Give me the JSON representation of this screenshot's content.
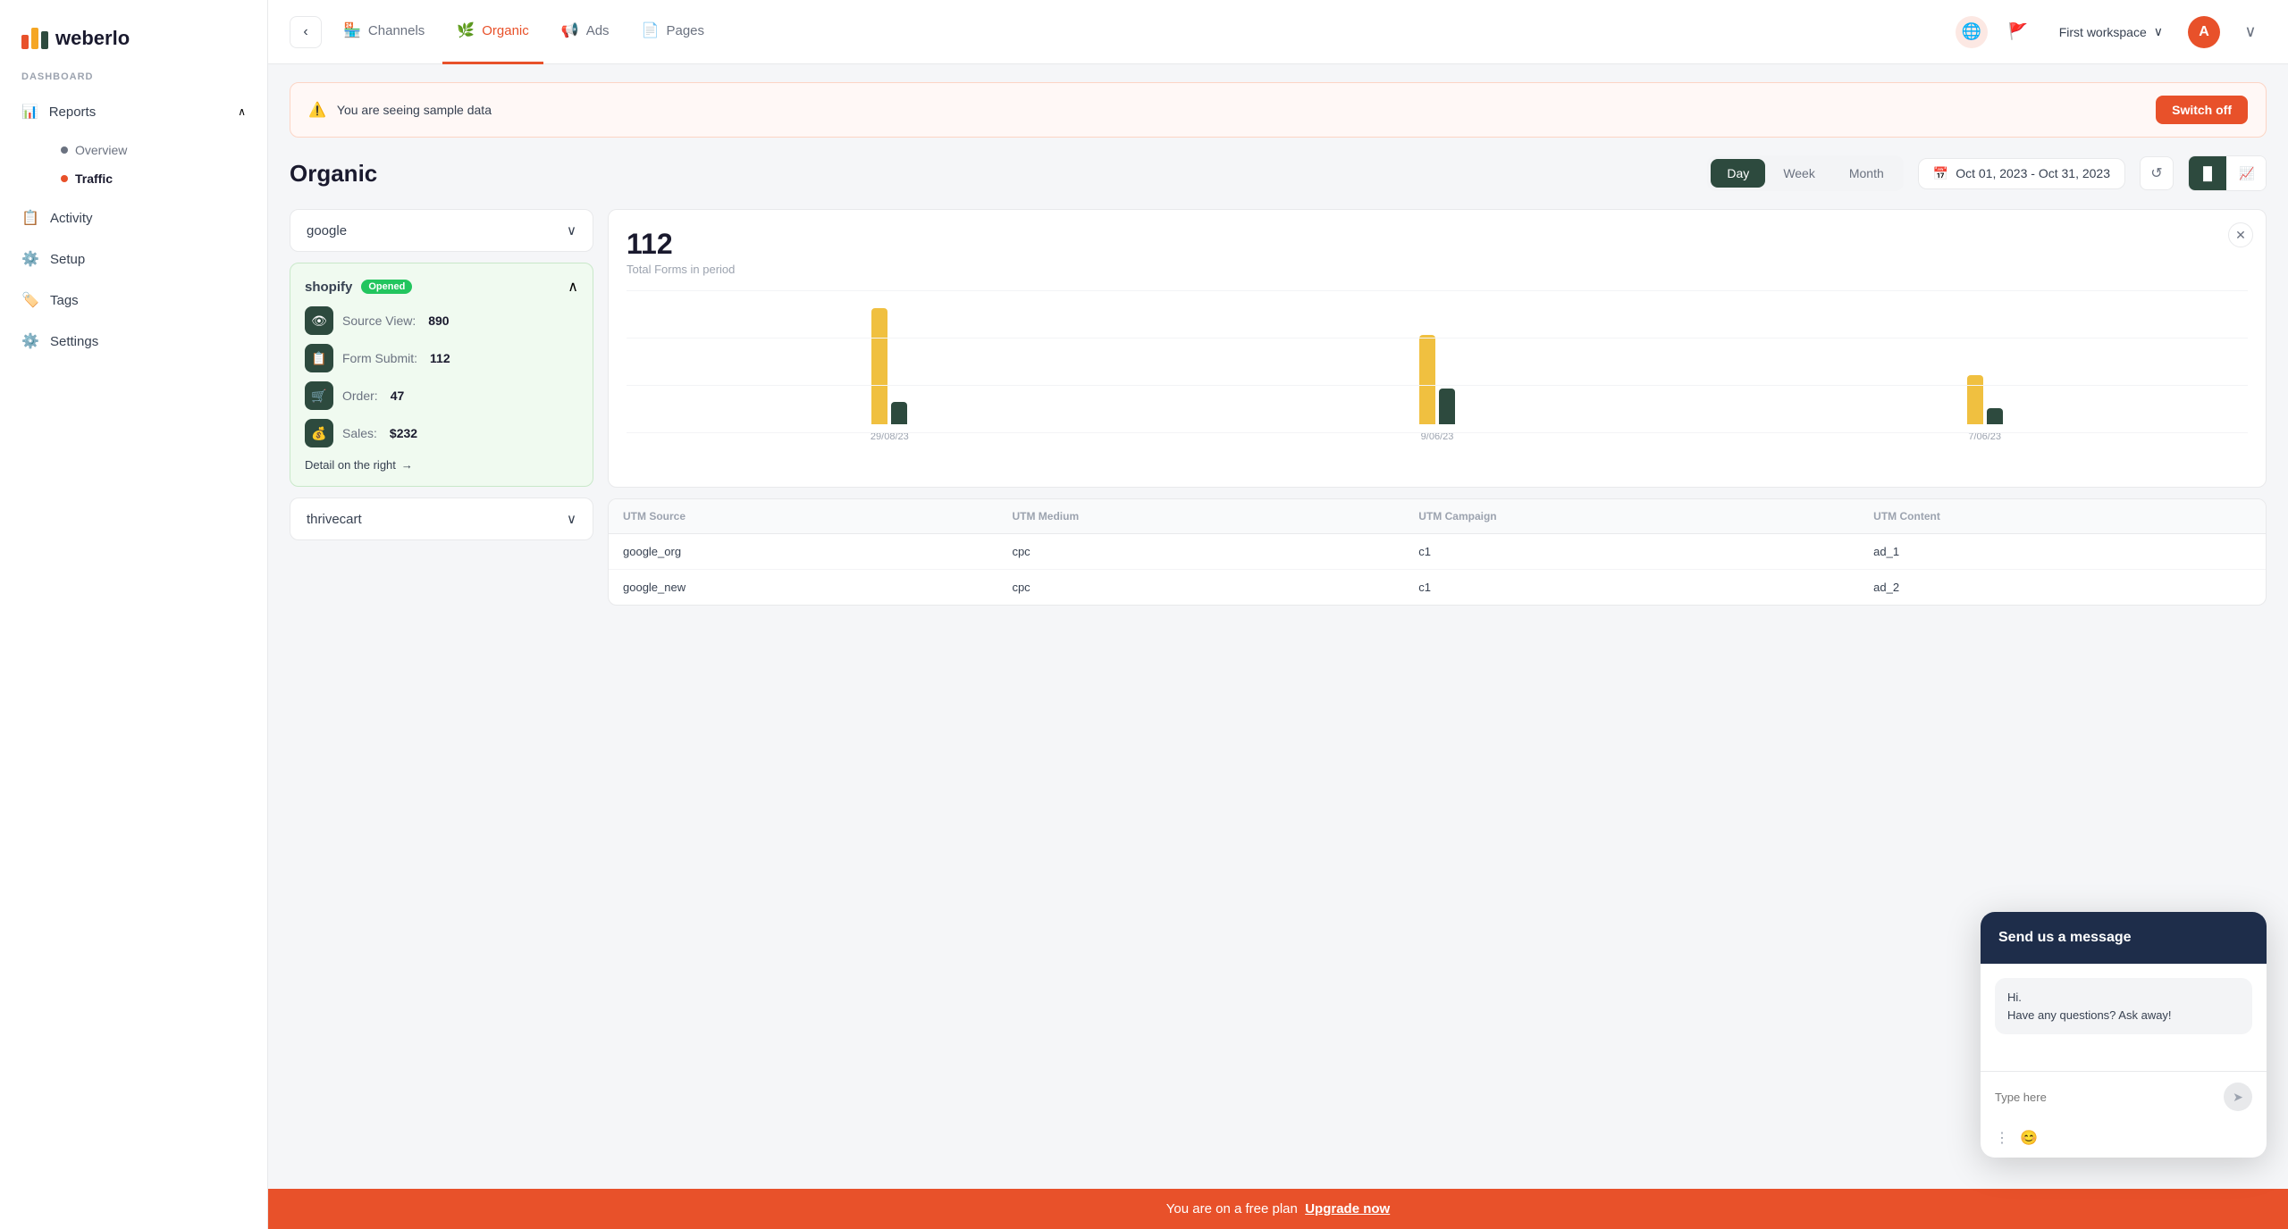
{
  "logo": {
    "text": "weberlo"
  },
  "sidebar": {
    "section_label": "DASHBOARD",
    "reports_label": "Reports",
    "reports_chevron": "∧",
    "sub_items": [
      {
        "label": "Overview",
        "active": false
      },
      {
        "label": "Traffic",
        "active": true
      }
    ],
    "nav_items": [
      {
        "label": "Activity",
        "icon": "📋"
      },
      {
        "label": "Setup",
        "icon": "⚙️"
      },
      {
        "label": "Tags",
        "icon": "🏷️"
      },
      {
        "label": "Settings",
        "icon": "⚙️"
      }
    ]
  },
  "topnav": {
    "tabs": [
      {
        "label": "Channels",
        "icon": "🏪",
        "active": false
      },
      {
        "label": "Organic",
        "icon": "🌿",
        "active": true
      },
      {
        "label": "Ads",
        "icon": "📢",
        "active": false
      },
      {
        "label": "Pages",
        "icon": "📄",
        "active": false
      }
    ],
    "workspace": "First workspace",
    "avatar_letter": "A"
  },
  "banner": {
    "text": "You are seeing sample data",
    "button": "Switch off"
  },
  "page": {
    "title": "Organic"
  },
  "time_filter": {
    "buttons": [
      "Day",
      "Week",
      "Month"
    ],
    "active": "Day",
    "date_range": "Oct 01, 2023 - Oct 31, 2023"
  },
  "source_dropdown": {
    "value": "google"
  },
  "shopify_card": {
    "title": "shopify",
    "badge": "Opened",
    "metrics": [
      {
        "label": "Source View:",
        "value": "890",
        "icon": "👁"
      },
      {
        "label": "Form Submit:",
        "value": "112",
        "icon": "📋"
      },
      {
        "label": "Order:",
        "value": "47",
        "icon": "🛒"
      },
      {
        "label": "Sales:",
        "value": "$232",
        "icon": "💰"
      }
    ],
    "detail_link": "Detail on the right"
  },
  "thrivecart": {
    "label": "thrivecart"
  },
  "chart": {
    "number": "112",
    "label": "Total Forms in period",
    "bars": [
      {
        "date": "29/08/23",
        "yellow_height": 130,
        "dark_height": 25
      },
      {
        "date": "9/06/23",
        "yellow_height": 100,
        "dark_height": 40
      },
      {
        "date": "7/06/23",
        "yellow_height": 55,
        "dark_height": 18
      }
    ]
  },
  "table": {
    "columns": [
      "UTM Source",
      "UTM Medium",
      "UTM Campaign",
      "UTM Content"
    ],
    "rows": [
      {
        "utm_source": "google_org",
        "utm_medium": "cpc",
        "utm_campaign": "c1",
        "utm_content": "ad_1"
      },
      {
        "utm_source": "google_new",
        "utm_medium": "cpc",
        "utm_campaign": "c1",
        "utm_content": "ad_2"
      }
    ]
  },
  "chat": {
    "header": "Send us a message",
    "bubble": "Hi.\nHave any questions? Ask away!",
    "input_placeholder": "Type here",
    "send_icon": "➤"
  },
  "bottom_bar": {
    "text": "You are on a free plan",
    "link_text": "Upgrade now"
  }
}
